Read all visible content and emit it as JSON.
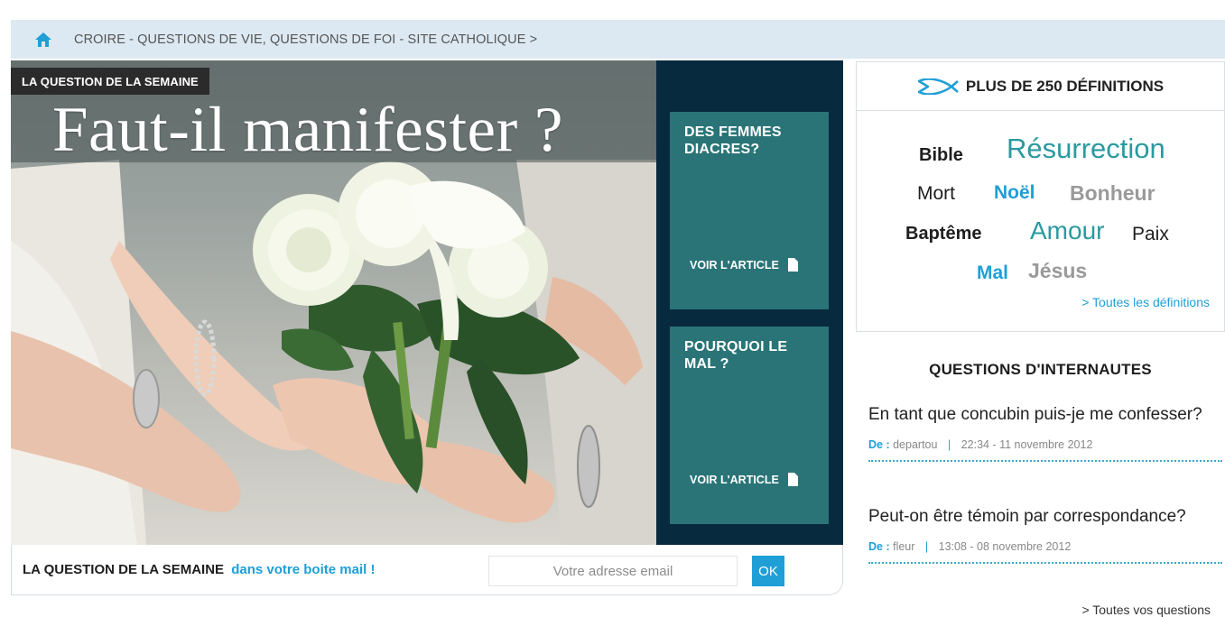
{
  "breadcrumb": {
    "text": "CROIRE - QUESTIONS DE VIE, QUESTIONS DE FOI - SITE CATHOLIQUE  >"
  },
  "hero": {
    "tag": "LA QUESTION DE LA SEMAINE",
    "title": "Faut-il manifester ?",
    "cards": [
      {
        "title": "DES FEMMES DIACRES?",
        "link": "VOIR L'ARTICLE"
      },
      {
        "title": "POURQUOI LE MAL ?",
        "link": "VOIR L'ARTICLE"
      }
    ]
  },
  "newsletter": {
    "label_bold": "LA QUESTION DE LA SEMAINE",
    "label_blue": "dans votre boite mail !",
    "placeholder": "Votre adresse email",
    "button": "OK"
  },
  "definitions": {
    "header": "PLUS DE 250 DÉFINITIONS",
    "words": [
      "Bible",
      "Résurrection",
      "Mort",
      "Noël",
      "Bonheur",
      "Baptême",
      "Amour",
      "Paix",
      "Mal",
      "Jésus"
    ],
    "all_link": "> Toutes les définitions"
  },
  "questions": {
    "header": "QUESTIONS D'INTERNAUTES",
    "items": [
      {
        "title": "En tant que concubin puis-je me confesser?",
        "by_label": "De :",
        "author": "departou",
        "sep": "|",
        "date": "22:34 - 11 novembre 2012"
      },
      {
        "title": "Peut-on être témoin par correspondance?",
        "by_label": "De :",
        "author": "fleur",
        "sep": "|",
        "date": "13:08 - 08 novembre 2012"
      }
    ],
    "all_link": "> Toutes vos questions"
  },
  "colors": {
    "accent": "#1f9fd6",
    "teal_card": "#2a7477",
    "navy": "#082a3f",
    "breadcrumb_bg": "#dde9f2"
  }
}
